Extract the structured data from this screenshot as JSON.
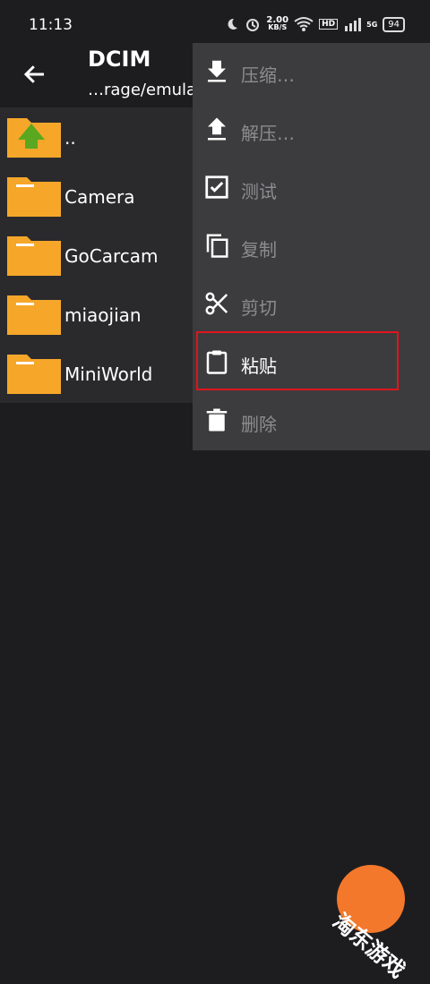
{
  "status_bar": {
    "time": "11:13",
    "net_speed": "2.00",
    "net_unit": "KB/S",
    "hd": "HD",
    "net": "5G",
    "battery": "94"
  },
  "header": {
    "title": "DCIM",
    "path": "…rage/emula"
  },
  "files": [
    {
      "name": ".."
    },
    {
      "name": "Camera"
    },
    {
      "name": "GoCarcam"
    },
    {
      "name": "miaojian"
    },
    {
      "name": "MiniWorld"
    }
  ],
  "menu": {
    "items": [
      {
        "label": "压缩…",
        "icon": "download-icon",
        "enabled": false
      },
      {
        "label": "解压…",
        "icon": "upload-icon",
        "enabled": false
      },
      {
        "label": "测试",
        "icon": "checkbox-icon",
        "enabled": false
      },
      {
        "label": "复制",
        "icon": "copy-icon",
        "enabled": false
      },
      {
        "label": "剪切",
        "icon": "scissors-icon",
        "enabled": false
      },
      {
        "label": "粘贴",
        "icon": "clipboard-icon",
        "enabled": true
      },
      {
        "label": "删除",
        "icon": "trash-icon",
        "enabled": false
      }
    ]
  },
  "watermark": "淘东游戏",
  "colors": {
    "background": "#1d1d20",
    "menu": "#3c3c3e",
    "folder": "#f6a72a",
    "highlight": "#e0141c",
    "watermark": "#f3782b"
  }
}
